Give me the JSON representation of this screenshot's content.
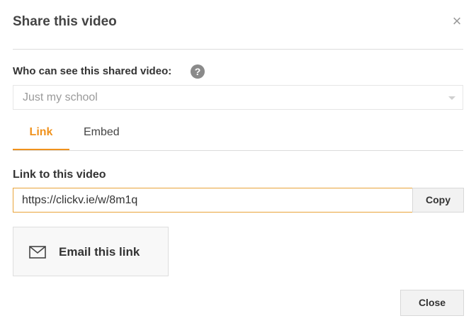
{
  "dialog": {
    "title": "Share this video",
    "close_icon": "close-icon"
  },
  "visibility": {
    "label": "Who can see this shared video:",
    "help_icon": "question-mark-icon",
    "help_glyph": "?",
    "selected": "Just my school"
  },
  "tabs": [
    {
      "label": "Link",
      "active": true
    },
    {
      "label": "Embed",
      "active": false
    }
  ],
  "link": {
    "label": "Link to this video",
    "url": "https://clickv.ie/w/8m1q",
    "copy_label": "Copy"
  },
  "email": {
    "icon": "envelope-icon",
    "label": "Email this link"
  },
  "footer": {
    "close_label": "Close"
  },
  "colors": {
    "accent": "#f0921d",
    "input_border": "#e9a43a"
  }
}
